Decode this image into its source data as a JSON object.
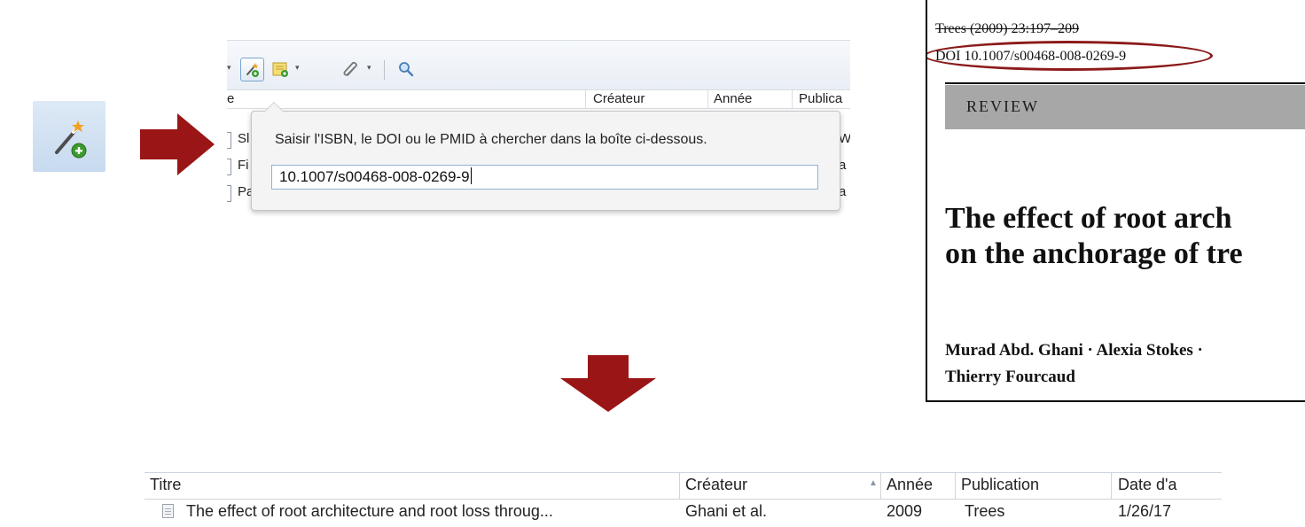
{
  "toolbar": {
    "icons": [
      "magic-wand-add-icon",
      "new-note-icon",
      "attachment-icon",
      "search-icon"
    ]
  },
  "zotero_list": {
    "header": {
      "title_fragment": "e",
      "creator": "Créateur",
      "year": "Année",
      "publication": "Publica"
    },
    "rows": [
      {
        "title_fragment": "Sl",
        "right_fragment": "W"
      },
      {
        "title_fragment": "Fi",
        "right_fragment": "a"
      },
      {
        "title_fragment": "Pa",
        "right_fragment": "a"
      }
    ]
  },
  "identifier_popup": {
    "message": "Saisir l'ISBN, le DOI ou le PMID à chercher dans la boîte ci-dessous.",
    "input_value": "10.1007/s00468-008-0269-9"
  },
  "pdf": {
    "citation": "Trees (2009) 23:197–209",
    "doi": "DOI 10.1007/s00468-008-0269-9",
    "section": "REVIEW",
    "title_line1": "The effect of root arch",
    "title_line2": "on the anchorage of tre",
    "authors_line1": "Murad Abd. Ghani · Alexia Stokes ·",
    "authors_line2": "Thierry Fourcaud"
  },
  "result_table": {
    "columns": {
      "title": "Titre",
      "creator": "Créateur",
      "year": "Année",
      "publication": "Publication",
      "date_added": "Date d'a"
    },
    "rows": [
      {
        "title": "The effect of root architecture and root loss throug...",
        "creator": "Ghani et al.",
        "year": "2009",
        "publication": "Trees",
        "date_added": "1/26/17"
      }
    ]
  },
  "colors": {
    "arrow": "#9a1515",
    "oval": "#8c1a1a",
    "highlight": "#c7daef"
  }
}
